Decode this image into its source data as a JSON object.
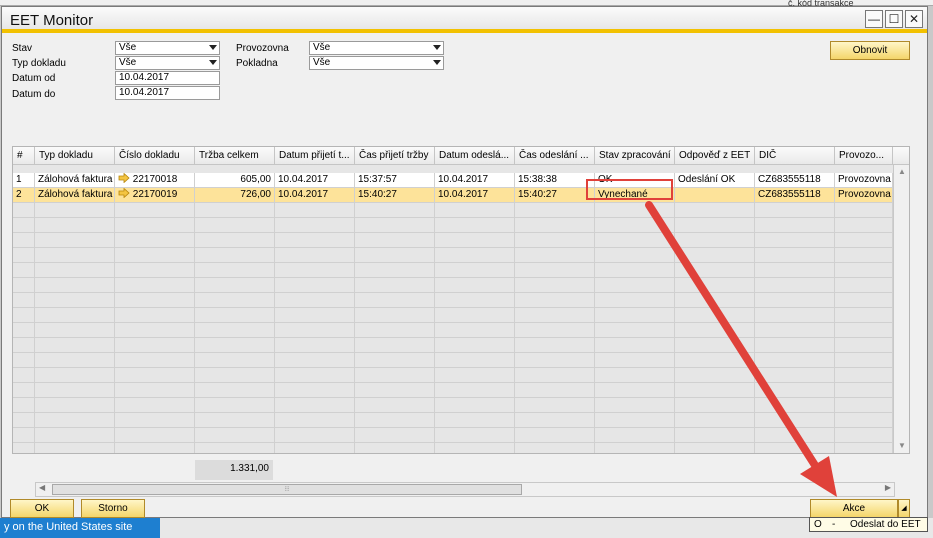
{
  "background": {
    "top_right_text": "č. kód transakce",
    "left_bottom_text": "y on the United States site"
  },
  "window": {
    "title": "EET Monitor",
    "minimize": "—",
    "maximize": "☐",
    "close": "✕"
  },
  "filters": {
    "stav": {
      "label": "Stav",
      "value": "Vše"
    },
    "typ_dokladu": {
      "label": "Typ dokladu",
      "value": "Vše"
    },
    "datum_od": {
      "label": "Datum od",
      "value": "10.04.2017"
    },
    "datum_do": {
      "label": "Datum do",
      "value": "10.04.2017"
    },
    "provozovna": {
      "label": "Provozovna",
      "value": "Vše"
    },
    "pokladna": {
      "label": "Pokladna",
      "value": "Vše"
    }
  },
  "buttons": {
    "obnovit": "Obnovit",
    "ok": "OK",
    "storno": "Storno",
    "akce": "Akce"
  },
  "table": {
    "headers": [
      "#",
      "Typ dokladu",
      "Číslo dokladu",
      "Tržba celkem",
      "Datum přijetí t...",
      "Čas přijetí tržby",
      "Datum odeslá...",
      "Čas odeslání ...",
      "Stav zpracování",
      "Odpověď z EET",
      "DIČ",
      "Provozo..."
    ],
    "rows": [
      {
        "num": "1",
        "typ": "Zálohová faktura",
        "cislo": "22170018",
        "trzba": "605,00",
        "datum_prijeti": "10.04.2017",
        "cas_prijeti": "15:37:57",
        "datum_odeslani": "10.04.2017",
        "cas_odeslani": "15:38:38",
        "stav": "OK",
        "odpoved": "Odeslání OK",
        "dic": "CZ683555118",
        "provozovna": "Provozovna"
      },
      {
        "num": "2",
        "typ": "Zálohová faktura",
        "cislo": "22170019",
        "trzba": "726,00",
        "datum_prijeti": "10.04.2017",
        "cas_prijeti": "15:40:27",
        "datum_odeslani": "10.04.2017",
        "cas_odeslani": "15:40:27",
        "stav": "Vynechané",
        "odpoved": "",
        "dic": "CZ683555118",
        "provozovna": "Provozovna"
      }
    ],
    "total": "1.331,00"
  },
  "dropdown": {
    "key": "O",
    "sep": "-",
    "label": "Odeslat do EET"
  },
  "colors": {
    "accent": "#f2c100",
    "selected_row": "#fde39a",
    "annotation": "#e0413a"
  }
}
